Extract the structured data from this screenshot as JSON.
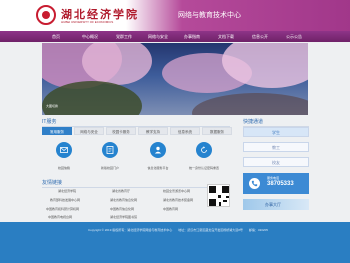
{
  "header": {
    "school_name": "湖北经济学院",
    "school_name_en": "HUBEI UNIVERSITY OF ECONOMICS",
    "site_title": "网络与教育技术中心"
  },
  "nav": {
    "items": [
      "首页",
      "中心概况",
      "党群工作",
      "网络与安全",
      "办事指南",
      "文档下载",
      "信息公开",
      "公示公告"
    ]
  },
  "banner": {
    "caption": "大图切换"
  },
  "services": {
    "title": "IT服务",
    "tabs": [
      "常用服务",
      "网络与安全",
      "校园卡服务",
      "教学支持",
      "信息系统",
      "数据服务"
    ],
    "items": [
      {
        "label": "校园信箱",
        "icon": "mail-icon"
      },
      {
        "label": "新版校园门户",
        "icon": "portal-icon"
      },
      {
        "label": "信息化服务平台",
        "icon": "person-icon"
      },
      {
        "label": "统一身份认证密码重置",
        "icon": "reset-icon"
      }
    ]
  },
  "quick": {
    "title": "快捷通道",
    "items": [
      "学生",
      "教工",
      "校友"
    ],
    "hotline_label": "服务电话",
    "hotline_number": "38705333",
    "hall_label": "办事大厅"
  },
  "links": {
    "title": "友情链接",
    "items": [
      [
        "湖北经济学院",
        "湖北省教育厅",
        "校园全景游览中心网"
      ],
      [
        "教育部科技发展中心网",
        "湖北省教育信息化网",
        "湖北省教育技术装备网"
      ],
      [
        "中国教育和科研计算机网",
        "中国教育信息化网",
        "中国教育网"
      ],
      [
        "中国教育电视台网",
        "湖北经济学院图书馆"
      ]
    ]
  },
  "footer": {
    "text": "Copyright © 2019 版权所有：湖北经济学院网络与教育技术中心　　地址：武汉市江夏区藏龙岛开发区杨桥湖大道8号　　邮编：430205"
  },
  "colors": {
    "brand_purple": "#8e3488",
    "brand_red": "#b01a2c",
    "accent_blue": "#2a7ec2"
  }
}
